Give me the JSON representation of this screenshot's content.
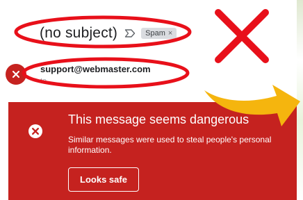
{
  "message": {
    "subject": "(no subject)",
    "important_marker_icon": "label-important-outline-icon",
    "spam_label": "Spam",
    "spam_remove": "×"
  },
  "sender": {
    "avatar_icon": "close-icon",
    "email": "support@webmaster.com",
    "recipient": "to"
  },
  "warning": {
    "icon": "close-circle-icon",
    "title": "This message seems dangerous",
    "description": "Similar messages were used to steal people's personal information.",
    "button_label": "Looks safe",
    "color": "#c5221f"
  },
  "annotations": {
    "highlight_color": "#e8101a",
    "arrow_color": "#f5b50e"
  }
}
